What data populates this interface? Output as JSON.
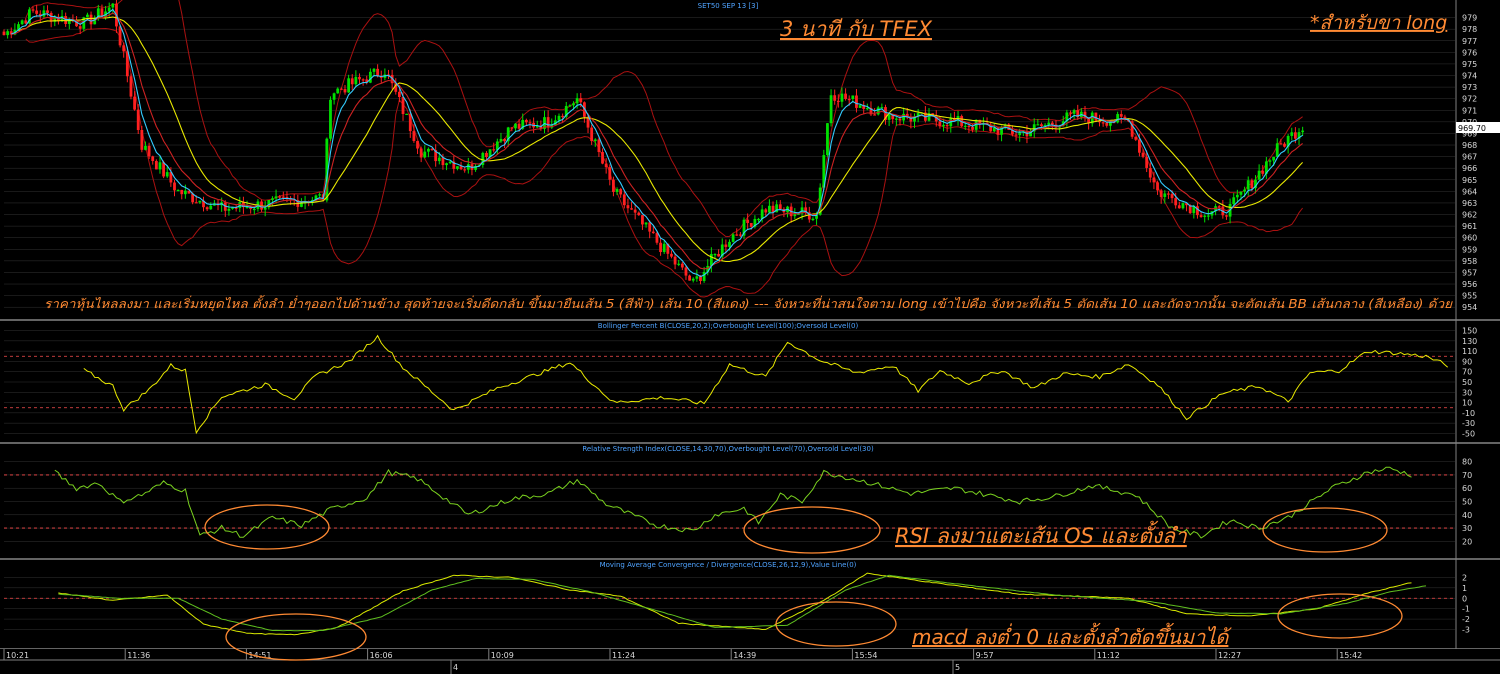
{
  "chart_data": [
    {
      "type": "candlestick",
      "title": "SET50 SEP 13   [3]",
      "ylim": [
        953.5,
        980
      ],
      "y_ticks": [
        954,
        955,
        956,
        957,
        958,
        959,
        960,
        961,
        962,
        963,
        964,
        965,
        966,
        967,
        968,
        969,
        970,
        971,
        972,
        973,
        974,
        975,
        976,
        977,
        978,
        979
      ],
      "last_price_label": "969.70",
      "series_colors": {
        "up": "#00e000",
        "down": "#ff2020",
        "ema5": "#33ccff",
        "ema10": "#cc2222",
        "bb_mid": "#e8e800",
        "bb_band": "#aa1111"
      },
      "anchors": [
        {
          "t": 0,
          "c": 977.5
        },
        {
          "t": 8,
          "c": 979.5
        },
        {
          "t": 22,
          "c": 978.5
        },
        {
          "t": 30,
          "c": 980
        },
        {
          "t": 38,
          "c": 968
        },
        {
          "t": 48,
          "c": 964
        },
        {
          "t": 60,
          "c": 962.5
        },
        {
          "t": 75,
          "c": 963
        },
        {
          "t": 88,
          "c": 963.5
        },
        {
          "t": 90,
          "c": 972.5
        },
        {
          "t": 105,
          "c": 974.5
        },
        {
          "t": 115,
          "c": 967.5
        },
        {
          "t": 128,
          "c": 966
        },
        {
          "t": 140,
          "c": 969.5
        },
        {
          "t": 150,
          "c": 970
        },
        {
          "t": 158,
          "c": 972
        },
        {
          "t": 168,
          "c": 964
        },
        {
          "t": 190,
          "c": 956
        },
        {
          "t": 200,
          "c": 960
        },
        {
          "t": 210,
          "c": 962.5
        },
        {
          "t": 224,
          "c": 962
        },
        {
          "t": 228,
          "c": 972.5
        },
        {
          "t": 245,
          "c": 970.5
        },
        {
          "t": 262,
          "c": 970
        },
        {
          "t": 280,
          "c": 969
        },
        {
          "t": 295,
          "c": 970.5
        },
        {
          "t": 310,
          "c": 970
        },
        {
          "t": 318,
          "c": 964
        },
        {
          "t": 332,
          "c": 962
        },
        {
          "t": 338,
          "c": 962.5
        },
        {
          "t": 352,
          "c": 968
        },
        {
          "t": 358,
          "c": 969.7
        }
      ],
      "annotations": {
        "title_note": "3 นาที กับ TFEX",
        "long_note": "*สำหรับขา long",
        "description": "ราคาหุ้นไหลลงมา และเริ่มหยุดไหล ตั้งลำ ย่ำๆออกไปด้านข้าง  สุดท้ายจะเริ่มดีดกลับ ขึ้นมายืนเส้น 5 (สีฟ้า) เส้น 10 (สีแดง) --- จังหวะที่น่าสนใจตาม long เข้าไปคือ จังหวะที่เส้น 5 ตัดเส้น 10 และถัดจากนั้น จะตัดเส้น BB เส้นกลาง (สีเหลือง) ด้วย"
      }
    },
    {
      "type": "line",
      "title": "Bollinger Percent B(CLOSE,20,2);Overbought Level(100);Oversold Level(0)",
      "ylim": [
        -55,
        155
      ],
      "y_ticks": [
        -50,
        -30,
        -10,
        10,
        30,
        50,
        70,
        90,
        110,
        130,
        150
      ],
      "levels": [
        100,
        0
      ],
      "anchors": [
        {
          "t": 22,
          "v": 73
        },
        {
          "t": 30,
          "v": 42
        },
        {
          "t": 33,
          "v": -3
        },
        {
          "t": 40,
          "v": 35
        },
        {
          "t": 46,
          "v": 82
        },
        {
          "t": 50,
          "v": 72
        },
        {
          "t": 53,
          "v": -45
        },
        {
          "t": 60,
          "v": 22
        },
        {
          "t": 72,
          "v": 45
        },
        {
          "t": 80,
          "v": 18
        },
        {
          "t": 86,
          "v": 62
        },
        {
          "t": 95,
          "v": 90
        },
        {
          "t": 103,
          "v": 138
        },
        {
          "t": 110,
          "v": 78
        },
        {
          "t": 124,
          "v": -5
        },
        {
          "t": 136,
          "v": 38
        },
        {
          "t": 150,
          "v": 73
        },
        {
          "t": 156,
          "v": 88
        },
        {
          "t": 168,
          "v": 10
        },
        {
          "t": 182,
          "v": 20
        },
        {
          "t": 193,
          "v": 8
        },
        {
          "t": 200,
          "v": 84
        },
        {
          "t": 210,
          "v": 60
        },
        {
          "t": 216,
          "v": 128
        },
        {
          "t": 225,
          "v": 92
        },
        {
          "t": 235,
          "v": 68
        },
        {
          "t": 245,
          "v": 82
        },
        {
          "t": 252,
          "v": 33
        },
        {
          "t": 258,
          "v": 72
        },
        {
          "t": 266,
          "v": 48
        },
        {
          "t": 275,
          "v": 73
        },
        {
          "t": 284,
          "v": 38
        },
        {
          "t": 292,
          "v": 66
        },
        {
          "t": 302,
          "v": 60
        },
        {
          "t": 310,
          "v": 85
        },
        {
          "t": 318,
          "v": 45
        },
        {
          "t": 326,
          "v": -20
        },
        {
          "t": 336,
          "v": 28
        },
        {
          "t": 346,
          "v": 42
        },
        {
          "t": 354,
          "v": 12
        },
        {
          "t": 360,
          "v": 68
        },
        {
          "t": 368,
          "v": 72
        },
        {
          "t": 376,
          "v": 110
        },
        {
          "t": 384,
          "v": 106
        },
        {
          "t": 392,
          "v": 100
        },
        {
          "t": 398,
          "v": 82
        }
      ]
    },
    {
      "type": "line",
      "title": "Relative Strength Index(CLOSE,14,30,70),Overbought Level(70),Oversold Level(30)",
      "ylim": [
        12,
        88
      ],
      "y_ticks": [
        20,
        30,
        40,
        50,
        60,
        70,
        80
      ],
      "levels": [
        70,
        30
      ],
      "anchors": [
        {
          "t": 14,
          "v": 72
        },
        {
          "t": 20,
          "v": 60
        },
        {
          "t": 26,
          "v": 64
        },
        {
          "t": 32,
          "v": 50
        },
        {
          "t": 38,
          "v": 55
        },
        {
          "t": 44,
          "v": 64
        },
        {
          "t": 50,
          "v": 58
        },
        {
          "t": 54,
          "v": 24
        },
        {
          "t": 60,
          "v": 30
        },
        {
          "t": 66,
          "v": 24
        },
        {
          "t": 74,
          "v": 38
        },
        {
          "t": 82,
          "v": 32
        },
        {
          "t": 90,
          "v": 44
        },
        {
          "t": 100,
          "v": 53
        },
        {
          "t": 106,
          "v": 72
        },
        {
          "t": 114,
          "v": 67
        },
        {
          "t": 128,
          "v": 40
        },
        {
          "t": 140,
          "v": 52
        },
        {
          "t": 150,
          "v": 56
        },
        {
          "t": 158,
          "v": 66
        },
        {
          "t": 166,
          "v": 48
        },
        {
          "t": 180,
          "v": 32
        },
        {
          "t": 190,
          "v": 28
        },
        {
          "t": 196,
          "v": 40
        },
        {
          "t": 204,
          "v": 45
        },
        {
          "t": 208,
          "v": 34
        },
        {
          "t": 214,
          "v": 55
        },
        {
          "t": 220,
          "v": 50
        },
        {
          "t": 226,
          "v": 72
        },
        {
          "t": 236,
          "v": 66
        },
        {
          "t": 250,
          "v": 56
        },
        {
          "t": 262,
          "v": 60
        },
        {
          "t": 280,
          "v": 50
        },
        {
          "t": 290,
          "v": 54
        },
        {
          "t": 300,
          "v": 62
        },
        {
          "t": 312,
          "v": 55
        },
        {
          "t": 322,
          "v": 30
        },
        {
          "t": 330,
          "v": 24
        },
        {
          "t": 338,
          "v": 36
        },
        {
          "t": 346,
          "v": 30
        },
        {
          "t": 354,
          "v": 38
        },
        {
          "t": 366,
          "v": 60
        },
        {
          "t": 376,
          "v": 72
        },
        {
          "t": 382,
          "v": 75
        },
        {
          "t": 388,
          "v": 70
        }
      ]
    },
    {
      "type": "line",
      "title": "Moving Average Convergence / Divergence(CLOSE,26,12,9),Value Line(0)",
      "ylim": [
        -4.2,
        3
      ],
      "y_ticks": [
        -3,
        -2,
        -1,
        0,
        1,
        2
      ],
      "levels": [
        0
      ],
      "macd": [
        {
          "t": 15,
          "v": 0.5
        },
        {
          "t": 30,
          "v": -0.2
        },
        {
          "t": 45,
          "v": 0.3
        },
        {
          "t": 55,
          "v": -2.5
        },
        {
          "t": 68,
          "v": -3.4
        },
        {
          "t": 80,
          "v": -3.5
        },
        {
          "t": 92,
          "v": -2.8
        },
        {
          "t": 110,
          "v": 0.7
        },
        {
          "t": 124,
          "v": 2.2
        },
        {
          "t": 140,
          "v": 2.0
        },
        {
          "t": 156,
          "v": 0.8
        },
        {
          "t": 170,
          "v": 0.2
        },
        {
          "t": 186,
          "v": -2.4
        },
        {
          "t": 210,
          "v": -3.0
        },
        {
          "t": 226,
          "v": -0.2
        },
        {
          "t": 238,
          "v": 2.4
        },
        {
          "t": 256,
          "v": 1.5
        },
        {
          "t": 280,
          "v": 0.4
        },
        {
          "t": 310,
          "v": 0.0
        },
        {
          "t": 326,
          "v": -1.5
        },
        {
          "t": 344,
          "v": -1.7
        },
        {
          "t": 362,
          "v": -1.0
        },
        {
          "t": 376,
          "v": 0.5
        },
        {
          "t": 388,
          "v": 1.5
        }
      ],
      "signal": [
        {
          "t": 15,
          "v": 0.4
        },
        {
          "t": 32,
          "v": 0.0
        },
        {
          "t": 48,
          "v": 0.0
        },
        {
          "t": 60,
          "v": -2.0
        },
        {
          "t": 74,
          "v": -3.1
        },
        {
          "t": 88,
          "v": -3.1
        },
        {
          "t": 104,
          "v": -1.8
        },
        {
          "t": 118,
          "v": 0.8
        },
        {
          "t": 130,
          "v": 1.9
        },
        {
          "t": 146,
          "v": 1.8
        },
        {
          "t": 162,
          "v": 0.6
        },
        {
          "t": 178,
          "v": -1.0
        },
        {
          "t": 196,
          "v": -2.8
        },
        {
          "t": 216,
          "v": -2.6
        },
        {
          "t": 232,
          "v": 0.8
        },
        {
          "t": 244,
          "v": 2.2
        },
        {
          "t": 262,
          "v": 1.4
        },
        {
          "t": 290,
          "v": 0.3
        },
        {
          "t": 316,
          "v": -0.3
        },
        {
          "t": 334,
          "v": -1.4
        },
        {
          "t": 352,
          "v": -1.5
        },
        {
          "t": 370,
          "v": -0.5
        },
        {
          "t": 382,
          "v": 0.6
        },
        {
          "t": 392,
          "v": 1.2
        }
      ]
    }
  ],
  "x_axis": {
    "time_labels": [
      "10:21",
      "11:36",
      "14:51",
      "16:06",
      "10:09",
      "11:24",
      "14:39",
      "15:54",
      "9:57",
      "11:12",
      "12:27",
      "15:42"
    ],
    "day_labels": [
      "4",
      "5"
    ]
  },
  "callouts": {
    "rsi": "RSI ลงมาแตะเส้น OS และตั้งลำ",
    "macd": "macd ลงต่ำ 0 และตั้งลำตัดขึ้นมาได้"
  }
}
